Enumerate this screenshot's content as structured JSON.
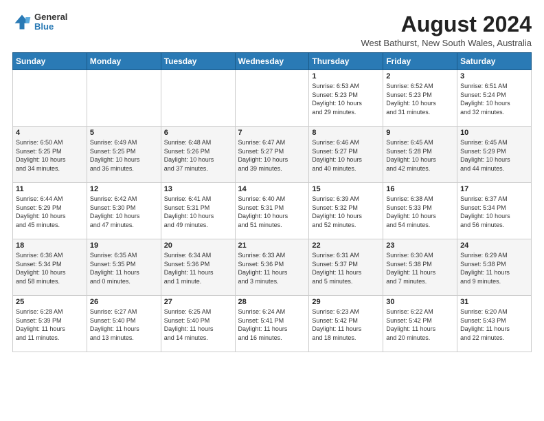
{
  "header": {
    "logo_general": "General",
    "logo_blue": "Blue",
    "month_title": "August 2024",
    "location": "West Bathurst, New South Wales, Australia"
  },
  "days_of_week": [
    "Sunday",
    "Monday",
    "Tuesday",
    "Wednesday",
    "Thursday",
    "Friday",
    "Saturday"
  ],
  "weeks": [
    [
      {
        "day": "",
        "info": ""
      },
      {
        "day": "",
        "info": ""
      },
      {
        "day": "",
        "info": ""
      },
      {
        "day": "",
        "info": ""
      },
      {
        "day": "1",
        "info": "Sunrise: 6:53 AM\nSunset: 5:23 PM\nDaylight: 10 hours\nand 29 minutes."
      },
      {
        "day": "2",
        "info": "Sunrise: 6:52 AM\nSunset: 5:23 PM\nDaylight: 10 hours\nand 31 minutes."
      },
      {
        "day": "3",
        "info": "Sunrise: 6:51 AM\nSunset: 5:24 PM\nDaylight: 10 hours\nand 32 minutes."
      }
    ],
    [
      {
        "day": "4",
        "info": "Sunrise: 6:50 AM\nSunset: 5:25 PM\nDaylight: 10 hours\nand 34 minutes."
      },
      {
        "day": "5",
        "info": "Sunrise: 6:49 AM\nSunset: 5:25 PM\nDaylight: 10 hours\nand 36 minutes."
      },
      {
        "day": "6",
        "info": "Sunrise: 6:48 AM\nSunset: 5:26 PM\nDaylight: 10 hours\nand 37 minutes."
      },
      {
        "day": "7",
        "info": "Sunrise: 6:47 AM\nSunset: 5:27 PM\nDaylight: 10 hours\nand 39 minutes."
      },
      {
        "day": "8",
        "info": "Sunrise: 6:46 AM\nSunset: 5:27 PM\nDaylight: 10 hours\nand 40 minutes."
      },
      {
        "day": "9",
        "info": "Sunrise: 6:45 AM\nSunset: 5:28 PM\nDaylight: 10 hours\nand 42 minutes."
      },
      {
        "day": "10",
        "info": "Sunrise: 6:45 AM\nSunset: 5:29 PM\nDaylight: 10 hours\nand 44 minutes."
      }
    ],
    [
      {
        "day": "11",
        "info": "Sunrise: 6:44 AM\nSunset: 5:29 PM\nDaylight: 10 hours\nand 45 minutes."
      },
      {
        "day": "12",
        "info": "Sunrise: 6:42 AM\nSunset: 5:30 PM\nDaylight: 10 hours\nand 47 minutes."
      },
      {
        "day": "13",
        "info": "Sunrise: 6:41 AM\nSunset: 5:31 PM\nDaylight: 10 hours\nand 49 minutes."
      },
      {
        "day": "14",
        "info": "Sunrise: 6:40 AM\nSunset: 5:31 PM\nDaylight: 10 hours\nand 51 minutes."
      },
      {
        "day": "15",
        "info": "Sunrise: 6:39 AM\nSunset: 5:32 PM\nDaylight: 10 hours\nand 52 minutes."
      },
      {
        "day": "16",
        "info": "Sunrise: 6:38 AM\nSunset: 5:33 PM\nDaylight: 10 hours\nand 54 minutes."
      },
      {
        "day": "17",
        "info": "Sunrise: 6:37 AM\nSunset: 5:34 PM\nDaylight: 10 hours\nand 56 minutes."
      }
    ],
    [
      {
        "day": "18",
        "info": "Sunrise: 6:36 AM\nSunset: 5:34 PM\nDaylight: 10 hours\nand 58 minutes."
      },
      {
        "day": "19",
        "info": "Sunrise: 6:35 AM\nSunset: 5:35 PM\nDaylight: 11 hours\nand 0 minutes."
      },
      {
        "day": "20",
        "info": "Sunrise: 6:34 AM\nSunset: 5:36 PM\nDaylight: 11 hours\nand 1 minute."
      },
      {
        "day": "21",
        "info": "Sunrise: 6:33 AM\nSunset: 5:36 PM\nDaylight: 11 hours\nand 3 minutes."
      },
      {
        "day": "22",
        "info": "Sunrise: 6:31 AM\nSunset: 5:37 PM\nDaylight: 11 hours\nand 5 minutes."
      },
      {
        "day": "23",
        "info": "Sunrise: 6:30 AM\nSunset: 5:38 PM\nDaylight: 11 hours\nand 7 minutes."
      },
      {
        "day": "24",
        "info": "Sunrise: 6:29 AM\nSunset: 5:38 PM\nDaylight: 11 hours\nand 9 minutes."
      }
    ],
    [
      {
        "day": "25",
        "info": "Sunrise: 6:28 AM\nSunset: 5:39 PM\nDaylight: 11 hours\nand 11 minutes."
      },
      {
        "day": "26",
        "info": "Sunrise: 6:27 AM\nSunset: 5:40 PM\nDaylight: 11 hours\nand 13 minutes."
      },
      {
        "day": "27",
        "info": "Sunrise: 6:25 AM\nSunset: 5:40 PM\nDaylight: 11 hours\nand 14 minutes."
      },
      {
        "day": "28",
        "info": "Sunrise: 6:24 AM\nSunset: 5:41 PM\nDaylight: 11 hours\nand 16 minutes."
      },
      {
        "day": "29",
        "info": "Sunrise: 6:23 AM\nSunset: 5:42 PM\nDaylight: 11 hours\nand 18 minutes."
      },
      {
        "day": "30",
        "info": "Sunrise: 6:22 AM\nSunset: 5:42 PM\nDaylight: 11 hours\nand 20 minutes."
      },
      {
        "day": "31",
        "info": "Sunrise: 6:20 AM\nSunset: 5:43 PM\nDaylight: 11 hours\nand 22 minutes."
      }
    ]
  ]
}
